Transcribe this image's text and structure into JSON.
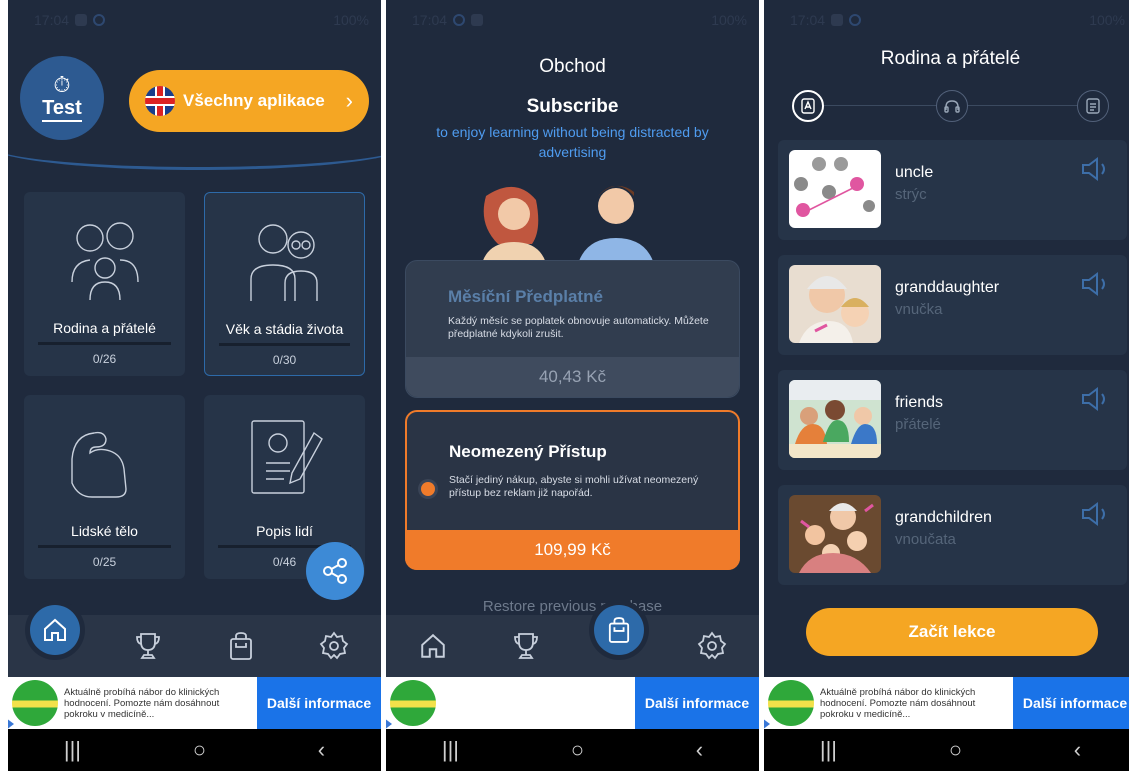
{
  "status": {
    "time": "17:04",
    "battery": "100%"
  },
  "screen1": {
    "test_label": "Test",
    "language_button": "Všechny aplikace",
    "categories": [
      {
        "name": "Rodina a přátelé",
        "count": "0/26"
      },
      {
        "name": "Věk a stádia života",
        "count": "0/30"
      },
      {
        "name": "Lidské tělo",
        "count": "0/25"
      },
      {
        "name": "Popis lidí",
        "count": "0/46"
      }
    ]
  },
  "screen2": {
    "title": "Obchod",
    "subtitle": "Subscribe",
    "tagline": "to enjoy learning without being distracted by advertising",
    "monthly": {
      "title": "Měsíční Předplatné",
      "desc": "Každý měsíc se poplatek obnovuje automaticky. Můžete předplatné kdykoli zrušit.",
      "price": "40,43 Kč"
    },
    "unlimited": {
      "title": "Neomezený Přístup",
      "desc": "Stačí jediný nákup, abyste si mohli užívat neomezený přístup bez reklam již napořád.",
      "price": "109,99 Kč"
    },
    "restore": "Restore previous purchase"
  },
  "screen3": {
    "title": "Rodina a přátelé",
    "words": [
      {
        "word": "uncle",
        "translation": "strýc"
      },
      {
        "word": "granddaughter",
        "translation": "vnučka"
      },
      {
        "word": "friends",
        "translation": "přátelé"
      },
      {
        "word": "grandchildren",
        "translation": "vnoučata"
      }
    ],
    "start_button": "Začít lekce"
  },
  "ad": {
    "text": "Aktuálně probíhá nábor do klinických hodnocení. Pomozte nám dosáhnout pokroku v medicíně...",
    "cta": "Další informace"
  },
  "colors": {
    "bg": "#1f2a3d",
    "card": "#263448",
    "accent_orange": "#f5a623",
    "accent_blue": "#2d6aa9",
    "price_orange": "#f07b2a"
  }
}
